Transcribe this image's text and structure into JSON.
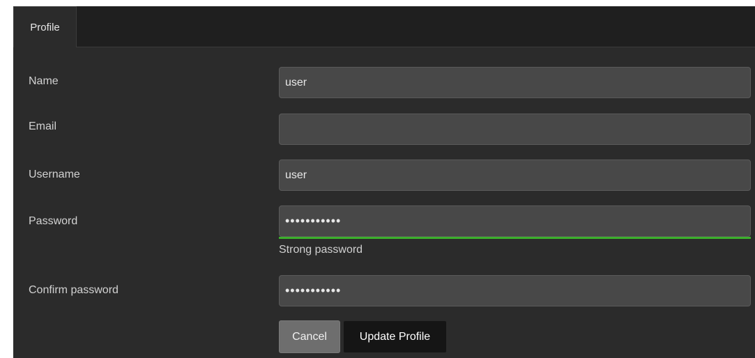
{
  "tabs": [
    {
      "label": "Profile"
    }
  ],
  "form": {
    "name": {
      "label": "Name",
      "value": "user"
    },
    "email": {
      "label": "Email",
      "value": ""
    },
    "username": {
      "label": "Username",
      "value": "user"
    },
    "password": {
      "label": "Password",
      "value": "•••••••••••"
    },
    "password_strength": {
      "text": "Strong password",
      "color": "#3cb02c"
    },
    "confirm_password": {
      "label": "Confirm password",
      "value": "•••••••••••"
    }
  },
  "actions": {
    "cancel_label": "Cancel",
    "update_label": "Update Profile"
  }
}
